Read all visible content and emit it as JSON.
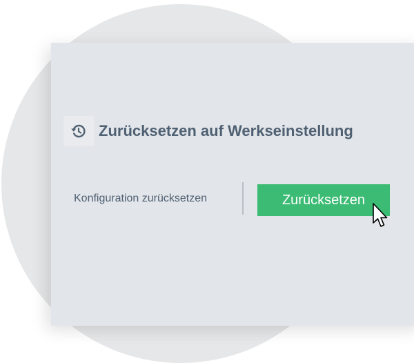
{
  "section": {
    "title": "Zurücksetzen auf Werkseinstellung",
    "icon": "reset-icon"
  },
  "action": {
    "label": "Konfiguration zurücksetzen",
    "button_label": "Zurücksetzen"
  },
  "colors": {
    "button": "#3bbb73",
    "text": "#4e6072",
    "panel": "#e2e5e9"
  }
}
